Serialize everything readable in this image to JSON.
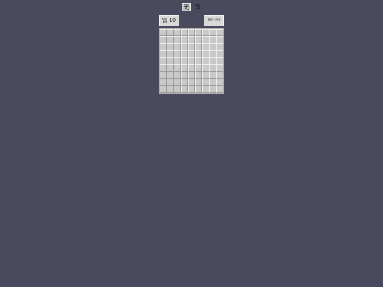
{
  "mode": {
    "dig_label": "无",
    "flag_label": "雷"
  },
  "counter": {
    "icon": "雷",
    "mines_remaining": "10"
  },
  "timer": {
    "value": "00:00"
  },
  "board": {
    "rows": 9,
    "cols": 9,
    "cell_state": "covered"
  },
  "colors": {
    "background": "#4a4a5e",
    "cell": "#c9c9c9"
  }
}
